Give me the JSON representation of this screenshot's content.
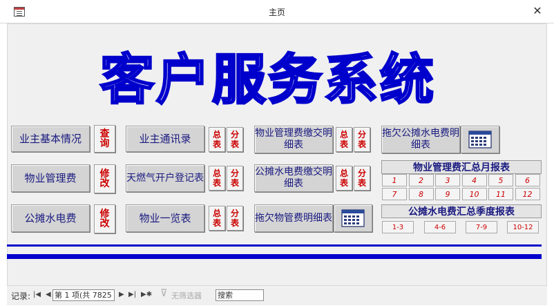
{
  "window": {
    "title": "主页",
    "close_glyph": "✕"
  },
  "header": {
    "title": "客户服务系统"
  },
  "buttons": {
    "owner_info": "业主基本情况",
    "owner_query": "查询",
    "owner_contacts": "业主通讯录",
    "contacts_total": "总表",
    "contacts_sub": "分表",
    "fee_detail": "物业管理费缴交明细表",
    "fee_detail_total": "总表",
    "fee_detail_sub": "分表",
    "arrears_util": "拖欠公摊水电费明细表",
    "mgmt_fee": "物业管理费",
    "mgmt_fee_edit": "修改",
    "gas_register": "天燃气开户登记表",
    "gas_total": "总表",
    "gas_sub": "分表",
    "util_detail": "公摊水电费缴交明细表",
    "util_detail_total": "总表",
    "util_detail_sub": "分表",
    "util_fee": "公摊水电费",
    "util_fee_edit": "修改",
    "property_list": "物业一览表",
    "property_total": "总表",
    "property_sub": "分表",
    "arrears_mgmt": "拖欠物管费明细表"
  },
  "monthly": {
    "title": "物业管理费汇总月报表",
    "months": [
      "1",
      "2",
      "3",
      "4",
      "5",
      "6",
      "7",
      "8",
      "9",
      "10",
      "11",
      "12"
    ]
  },
  "quarterly": {
    "title": "公摊水电费汇总季度报表",
    "quarters": [
      "1-3",
      "4-6",
      "7-9",
      "10-12"
    ]
  },
  "navbar": {
    "record_label": "记录:",
    "record_value": "第 1 项(共 7825",
    "filter_label": "无筛选器",
    "search_label": "搜索"
  },
  "colors": {
    "accent": "#0000cc",
    "label_red": "#cc0000",
    "button_text": "#1a1a80"
  }
}
